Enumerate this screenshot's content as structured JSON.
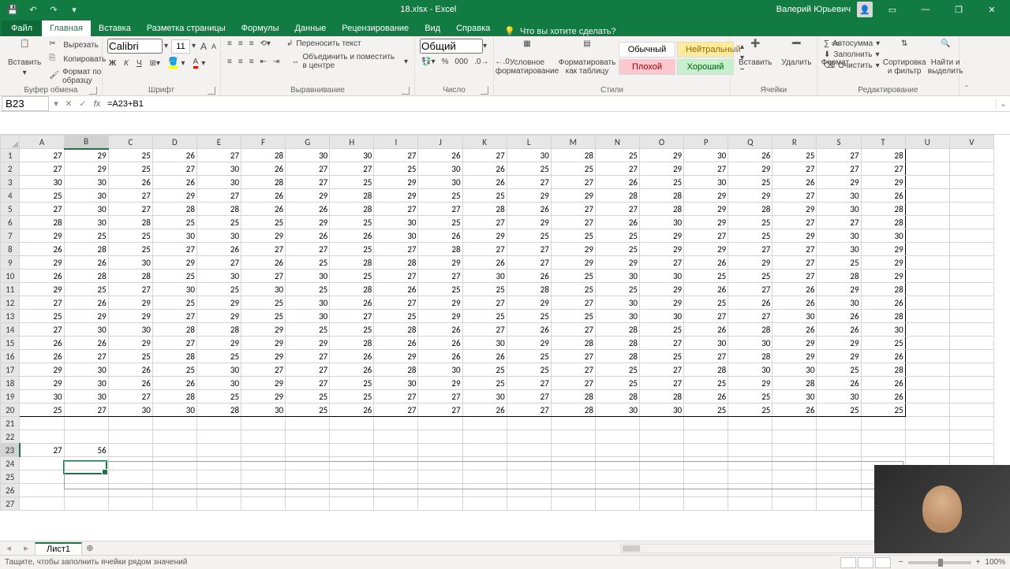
{
  "app": {
    "title": "18.xlsx - Excel",
    "user": "Валерий Юрьевич"
  },
  "qat": {
    "save": "💾",
    "undo": "↶",
    "redo": "↷",
    "custom": "▾"
  },
  "tabs": {
    "file": "Файл",
    "items": [
      "Главная",
      "Вставка",
      "Разметка страницы",
      "Формулы",
      "Данные",
      "Рецензирование",
      "Вид",
      "Справка"
    ],
    "active": 0,
    "tell_me": "Что вы хотите сделать?"
  },
  "ribbon": {
    "clipboard": {
      "paste": "Вставить",
      "cut": "Вырезать",
      "copy": "Копировать",
      "painter": "Формат по образцу",
      "label": "Буфер обмена"
    },
    "font": {
      "name": "Calibri",
      "size": "11",
      "bold": "Ж",
      "italic": "К",
      "underline": "Ч",
      "label": "Шрифт"
    },
    "align": {
      "wrap": "Переносить текст",
      "merge": "Объединить и поместить в центре",
      "label": "Выравнивание"
    },
    "number": {
      "format": "Общий",
      "label": "Число"
    },
    "styles": {
      "cond": "Условное форматирование",
      "table": "Форматировать как таблицу",
      "normal": "Обычный",
      "neutral": "Нейтральный",
      "bad": "Плохой",
      "good": "Хороший",
      "label": "Стили"
    },
    "cells": {
      "insert": "Вставить",
      "delete": "Удалить",
      "format": "Формат",
      "label": "Ячейки"
    },
    "editing": {
      "autosum": "Автосумма",
      "fill": "Заполнить",
      "clear": "Очистить",
      "sort": "Сортировка и фильтр",
      "find": "Найти и выделить",
      "label": "Редактирование"
    }
  },
  "fbar": {
    "name_box": "B23",
    "formula": "=A23+B1"
  },
  "grid": {
    "cols": [
      "A",
      "B",
      "C",
      "D",
      "E",
      "F",
      "G",
      "H",
      "I",
      "J",
      "K",
      "L",
      "M",
      "N",
      "O",
      "P",
      "Q",
      "R",
      "S",
      "T",
      "U",
      "V"
    ],
    "selected_col_index": 1,
    "selected_row_index": 22,
    "rows": [
      [
        27,
        29,
        25,
        26,
        27,
        28,
        30,
        30,
        27,
        26,
        27,
        30,
        28,
        25,
        29,
        30,
        26,
        25,
        27,
        28,
        "",
        ""
      ],
      [
        27,
        29,
        25,
        27,
        30,
        26,
        27,
        27,
        25,
        30,
        26,
        25,
        25,
        27,
        29,
        27,
        29,
        27,
        27,
        27,
        "",
        ""
      ],
      [
        30,
        30,
        26,
        26,
        30,
        28,
        27,
        25,
        29,
        30,
        26,
        27,
        27,
        26,
        25,
        30,
        25,
        26,
        29,
        29,
        "",
        ""
      ],
      [
        25,
        30,
        27,
        29,
        27,
        26,
        29,
        28,
        29,
        25,
        25,
        29,
        29,
        28,
        28,
        29,
        29,
        27,
        30,
        26,
        "",
        ""
      ],
      [
        27,
        30,
        27,
        28,
        28,
        26,
        26,
        28,
        27,
        27,
        28,
        26,
        27,
        27,
        28,
        29,
        28,
        29,
        30,
        28,
        "",
        ""
      ],
      [
        28,
        30,
        28,
        25,
        25,
        25,
        29,
        25,
        30,
        25,
        27,
        29,
        27,
        26,
        30,
        29,
        25,
        27,
        27,
        28,
        "",
        ""
      ],
      [
        29,
        25,
        25,
        30,
        30,
        29,
        26,
        26,
        30,
        26,
        29,
        25,
        25,
        25,
        29,
        27,
        25,
        29,
        30,
        30,
        "",
        ""
      ],
      [
        26,
        28,
        25,
        27,
        26,
        27,
        27,
        25,
        27,
        28,
        27,
        27,
        29,
        25,
        29,
        29,
        27,
        27,
        30,
        29,
        "",
        ""
      ],
      [
        29,
        26,
        30,
        29,
        27,
        26,
        25,
        28,
        28,
        29,
        26,
        27,
        29,
        29,
        27,
        26,
        29,
        27,
        25,
        29,
        "",
        ""
      ],
      [
        26,
        28,
        28,
        25,
        30,
        27,
        30,
        25,
        27,
        27,
        30,
        26,
        25,
        30,
        30,
        25,
        25,
        27,
        28,
        29,
        "",
        ""
      ],
      [
        29,
        25,
        27,
        30,
        25,
        30,
        25,
        28,
        26,
        25,
        25,
        28,
        25,
        25,
        29,
        26,
        27,
        26,
        29,
        28,
        "",
        ""
      ],
      [
        27,
        26,
        29,
        25,
        29,
        25,
        30,
        26,
        27,
        29,
        27,
        29,
        27,
        30,
        29,
        25,
        26,
        26,
        30,
        26,
        "",
        ""
      ],
      [
        25,
        29,
        29,
        27,
        29,
        25,
        30,
        27,
        25,
        29,
        25,
        25,
        25,
        30,
        30,
        27,
        27,
        30,
        26,
        28,
        "",
        ""
      ],
      [
        27,
        30,
        30,
        28,
        28,
        29,
        25,
        25,
        28,
        26,
        27,
        26,
        27,
        28,
        25,
        26,
        28,
        26,
        26,
        30,
        "",
        ""
      ],
      [
        26,
        26,
        29,
        27,
        29,
        29,
        29,
        28,
        26,
        26,
        30,
        29,
        28,
        28,
        27,
        30,
        30,
        29,
        29,
        25,
        "",
        ""
      ],
      [
        26,
        27,
        25,
        28,
        25,
        29,
        27,
        26,
        29,
        26,
        26,
        25,
        27,
        28,
        25,
        27,
        28,
        29,
        29,
        26,
        "",
        ""
      ],
      [
        29,
        30,
        26,
        25,
        30,
        27,
        27,
        26,
        28,
        30,
        25,
        25,
        27,
        25,
        27,
        28,
        30,
        30,
        25,
        28,
        "",
        ""
      ],
      [
        29,
        30,
        26,
        26,
        30,
        29,
        27,
        25,
        30,
        29,
        25,
        27,
        27,
        25,
        27,
        25,
        29,
        28,
        26,
        26,
        "",
        ""
      ],
      [
        30,
        30,
        27,
        28,
        25,
        29,
        25,
        25,
        27,
        27,
        30,
        27,
        28,
        28,
        28,
        26,
        25,
        30,
        30,
        26,
        "",
        ""
      ],
      [
        25,
        27,
        30,
        30,
        28,
        30,
        25,
        26,
        27,
        27,
        26,
        27,
        28,
        30,
        30,
        25,
        25,
        26,
        25,
        25,
        "",
        ""
      ],
      [
        "",
        "",
        "",
        "",
        "",
        "",
        "",
        "",
        "",
        "",
        "",
        "",
        "",
        "",
        "",
        "",
        "",
        "",
        "",
        "",
        "",
        ""
      ],
      [
        "",
        "",
        "",
        "",
        "",
        "",
        "",
        "",
        "",
        "",
        "",
        "",
        "",
        "",
        "",
        "",
        "",
        "",
        "",
        "",
        "",
        ""
      ],
      [
        27,
        56,
        "",
        "",
        "",
        "",
        "",
        "",
        "",
        "",
        "",
        "",
        "",
        "",
        "",
        "",
        "",
        "",
        "",
        "",
        "",
        ""
      ],
      [
        "",
        "",
        "",
        "",
        "",
        "",
        "",
        "",
        "",
        "",
        "",
        "",
        "",
        "",
        "",
        "",
        "",
        "",
        "",
        "",
        "",
        ""
      ],
      [
        "",
        "",
        "",
        "",
        "",
        "",
        "",
        "",
        "",
        "",
        "",
        "",
        "",
        "",
        "",
        "",
        "",
        "",
        "",
        "",
        "",
        ""
      ],
      [
        "",
        "",
        "",
        "",
        "",
        "",
        "",
        "",
        "",
        "",
        "",
        "",
        "",
        "",
        "",
        "",
        "",
        "",
        "",
        "",
        "",
        ""
      ],
      [
        "",
        "",
        "",
        "",
        "",
        "",
        "",
        "",
        "",
        "",
        "",
        "",
        "",
        "",
        "",
        "",
        "",
        "",
        "",
        "",
        "",
        ""
      ]
    ]
  },
  "sheet": {
    "name": "Лист1"
  },
  "status": {
    "msg": "Тащите, чтобы заполнить ячейки рядом значений",
    "zoom": "100%"
  }
}
